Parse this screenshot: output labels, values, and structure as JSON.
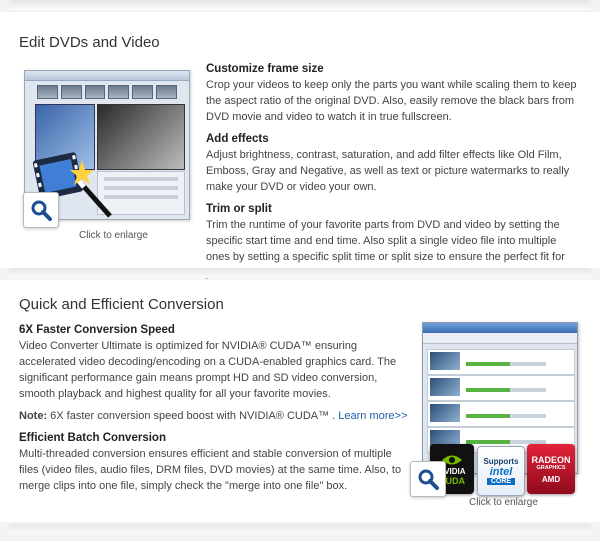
{
  "section1": {
    "title": "Edit DVDs and Video",
    "items": [
      {
        "title": "Customize frame size",
        "desc": "Crop your videos to keep only the parts you want while scaling them to keep the aspect ratio of the original DVD. Also, easily remove the black bars from DVD movie and video to watch it in true fullscreen."
      },
      {
        "title": "Add effects",
        "desc": "Adjust brightness, contrast, saturation, and add filter effects like Old Film, Emboss, Gray and Negative, as well as text or picture watermarks to really make your DVD or video your own."
      },
      {
        "title": "Trim or split",
        "desc": "Trim the runtime of your favorite parts from DVD and video by setting the specific start time and end time. Also split a single video file into multiple ones by setting a specific split time or split size to ensure the perfect fit for your device's screen."
      }
    ],
    "caption": "Click to enlarge"
  },
  "section2": {
    "title": "Quick and Efficient Conversion",
    "item1": {
      "title": "6X Faster Conversion Speed",
      "desc": "Video Converter Ultimate is optimized for NVIDIA® CUDA™ ensuring accelerated video decoding/encoding on a CUDA-enabled graphics card. The significant performance gain means prompt HD and SD video conversion, smooth playback and highest quality for all your favorite movies."
    },
    "note_label": "Note:",
    "note_text": " 6X faster conversion speed boost with NVIDIA® CUDA™ . ",
    "note_link": "Learn more>>",
    "item2": {
      "title": "Efficient Batch Conversion",
      "desc": "Multi-threaded conversion ensures efficient and stable conversion of multiple files (video files, audio files, DRM files, DVD movies) at the same time. Also, to merge clips into one file, simply check the \"merge into one file\" box."
    },
    "caption": "Click to enlarge",
    "badges": {
      "nvidia": {
        "name": "NVIDIA",
        "sub": "CUDA"
      },
      "intel": {
        "top": "Supports",
        "name": "intel",
        "sub": "CORE"
      },
      "amd": {
        "name": "RADEON",
        "mid": "GRAPHICS",
        "sub": "AMD"
      }
    }
  },
  "colors": {
    "link": "#1f5fa9",
    "nvidia_green": "#76b900",
    "intel_blue": "#0a6fc2",
    "amd_red": "#c8102e"
  }
}
